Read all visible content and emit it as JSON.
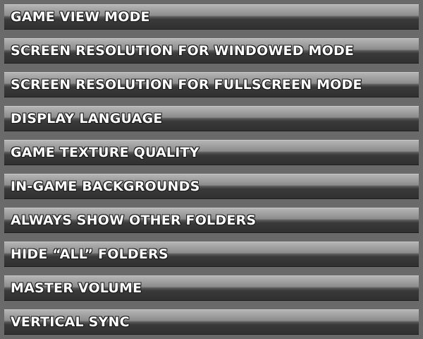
{
  "settings_menu": {
    "items": [
      {
        "label": "GAME VIEW MODE"
      },
      {
        "label": "SCREEN RESOLUTION FOR WINDOWED MODE"
      },
      {
        "label": "SCREEN RESOLUTION FOR FULLSCREEN MODE"
      },
      {
        "label": "DISPLAY LANGUAGE"
      },
      {
        "label": "GAME TEXTURE QUALITY"
      },
      {
        "label": "IN-GAME BACKGROUNDS"
      },
      {
        "label": "ALWAYS SHOW OTHER FOLDERS"
      },
      {
        "label": "HIDE “ALL” FOLDERS"
      },
      {
        "label": "MASTER VOLUME"
      },
      {
        "label": "VERTICAL SYNC"
      }
    ]
  }
}
